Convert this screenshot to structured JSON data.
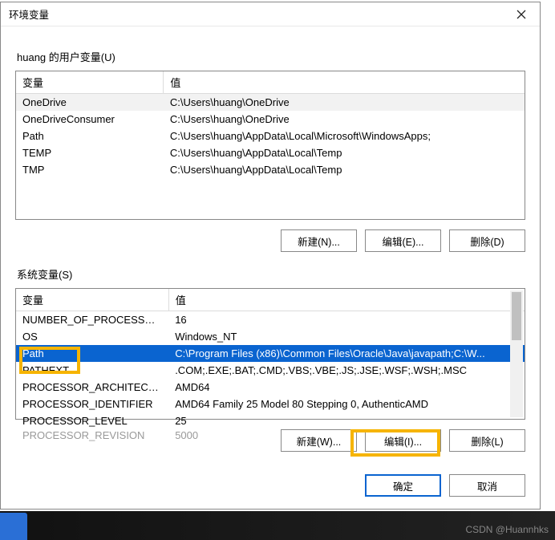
{
  "dialog": {
    "title": "环境变量",
    "close_tooltip": "关闭",
    "user_section_label": "huang 的用户变量(U)",
    "system_section_label": "系统变量(S)",
    "col_name": "变量",
    "col_value": "值",
    "btn_new_user": "新建(N)...",
    "btn_edit_user": "编辑(E)...",
    "btn_del_user": "删除(D)",
    "btn_new_sys": "新建(W)...",
    "btn_edit_sys": "编辑(I)...",
    "btn_del_sys": "删除(L)",
    "btn_ok": "确定",
    "btn_cancel": "取消"
  },
  "user_vars": [
    {
      "name": "OneDrive",
      "value": "C:\\Users\\huang\\OneDrive"
    },
    {
      "name": "OneDriveConsumer",
      "value": "C:\\Users\\huang\\OneDrive"
    },
    {
      "name": "Path",
      "value": "C:\\Users\\huang\\AppData\\Local\\Microsoft\\WindowsApps;"
    },
    {
      "name": "TEMP",
      "value": "C:\\Users\\huang\\AppData\\Local\\Temp"
    },
    {
      "name": "TMP",
      "value": "C:\\Users\\huang\\AppData\\Local\\Temp"
    }
  ],
  "sys_vars": [
    {
      "name": "NUMBER_OF_PROCESSORS",
      "value": "16"
    },
    {
      "name": "OS",
      "value": "Windows_NT"
    },
    {
      "name": "Path",
      "value": "C:\\Program Files (x86)\\Common Files\\Oracle\\Java\\javapath;C:\\W..."
    },
    {
      "name": "PATHEXT",
      "value": ".COM;.EXE;.BAT;.CMD;.VBS;.VBE;.JS;.JSE;.WSF;.WSH;.MSC"
    },
    {
      "name": "PROCESSOR_ARCHITECTURE",
      "value": "AMD64"
    },
    {
      "name": "PROCESSOR_IDENTIFIER",
      "value": "AMD64 Family 25 Model 80 Stepping 0, AuthenticAMD"
    },
    {
      "name": "PROCESSOR_LEVEL",
      "value": "25"
    },
    {
      "name": "PROCESSOR_REVISION",
      "value": "5000"
    }
  ],
  "highlight": {
    "path_box": true,
    "edit_box": true
  },
  "watermark": "CSDN @Huannhks"
}
